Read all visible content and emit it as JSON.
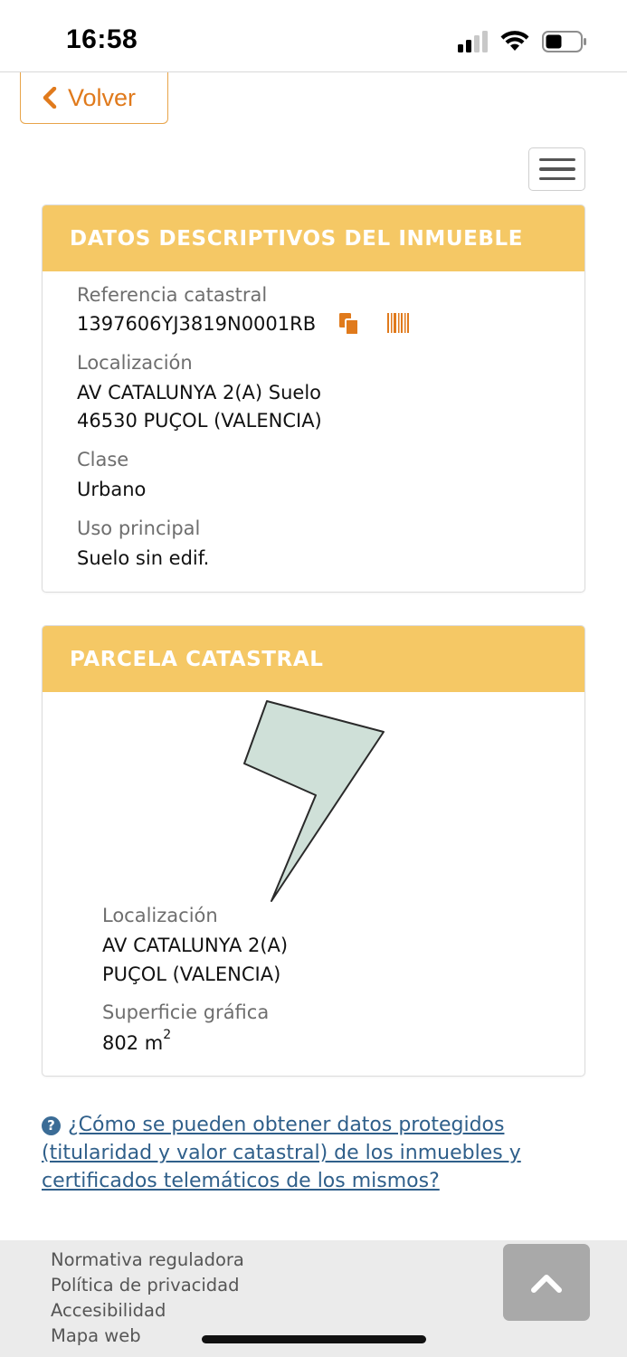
{
  "status_bar": {
    "time": "16:58",
    "icons": [
      "cellular-signal-icon",
      "wifi-icon",
      "battery-icon"
    ]
  },
  "nav": {
    "back_label": "Volver",
    "back_icon": "chevron-left-icon",
    "menu_icon": "hamburger-menu-icon"
  },
  "panel_descriptivos": {
    "title": "DATOS DESCRIPTIVOS DEL INMUEBLE",
    "ref_label": "Referencia catastral",
    "ref_value": "1397606YJ3819N0001RB",
    "ref_icons": [
      "copy-icon",
      "barcode-icon"
    ],
    "loc_label": "Localización",
    "loc_line1": "AV CATALUNYA 2(A) Suelo",
    "loc_line2": "46530 PUÇOL (VALENCIA)",
    "clase_label": "Clase",
    "clase_value": "Urbano",
    "uso_label": "Uso principal",
    "uso_value": "Suelo sin edif."
  },
  "panel_parcela": {
    "title": "PARCELA CATASTRAL",
    "map_icon": "parcel-shape",
    "loc_label": "Localización",
    "loc_line1": "AV CATALUNYA 2(A)",
    "loc_line2": "PUÇOL (VALENCIA)",
    "sup_label": "Superficie gráfica",
    "sup_value": "802 m",
    "sup_unit_sup": "2"
  },
  "help": {
    "icon": "question-circle-icon",
    "link_text": "¿Cómo se pueden obtener datos protegidos (titularidad y valor catastral) de los inmuebles y certificados telemáticos de los mismos?"
  },
  "footer": {
    "links": [
      "Normativa reguladora",
      "Política de privacidad",
      "Accesibilidad",
      "Mapa web"
    ],
    "up_icon": "chevron-up-icon"
  },
  "colors": {
    "accent_orange": "#e07a1c",
    "panel_header": "#f5c865",
    "parcel_fill": "#cfe0d8",
    "link_blue": "#2f5f8a",
    "footer_bg": "#ebebeb"
  }
}
